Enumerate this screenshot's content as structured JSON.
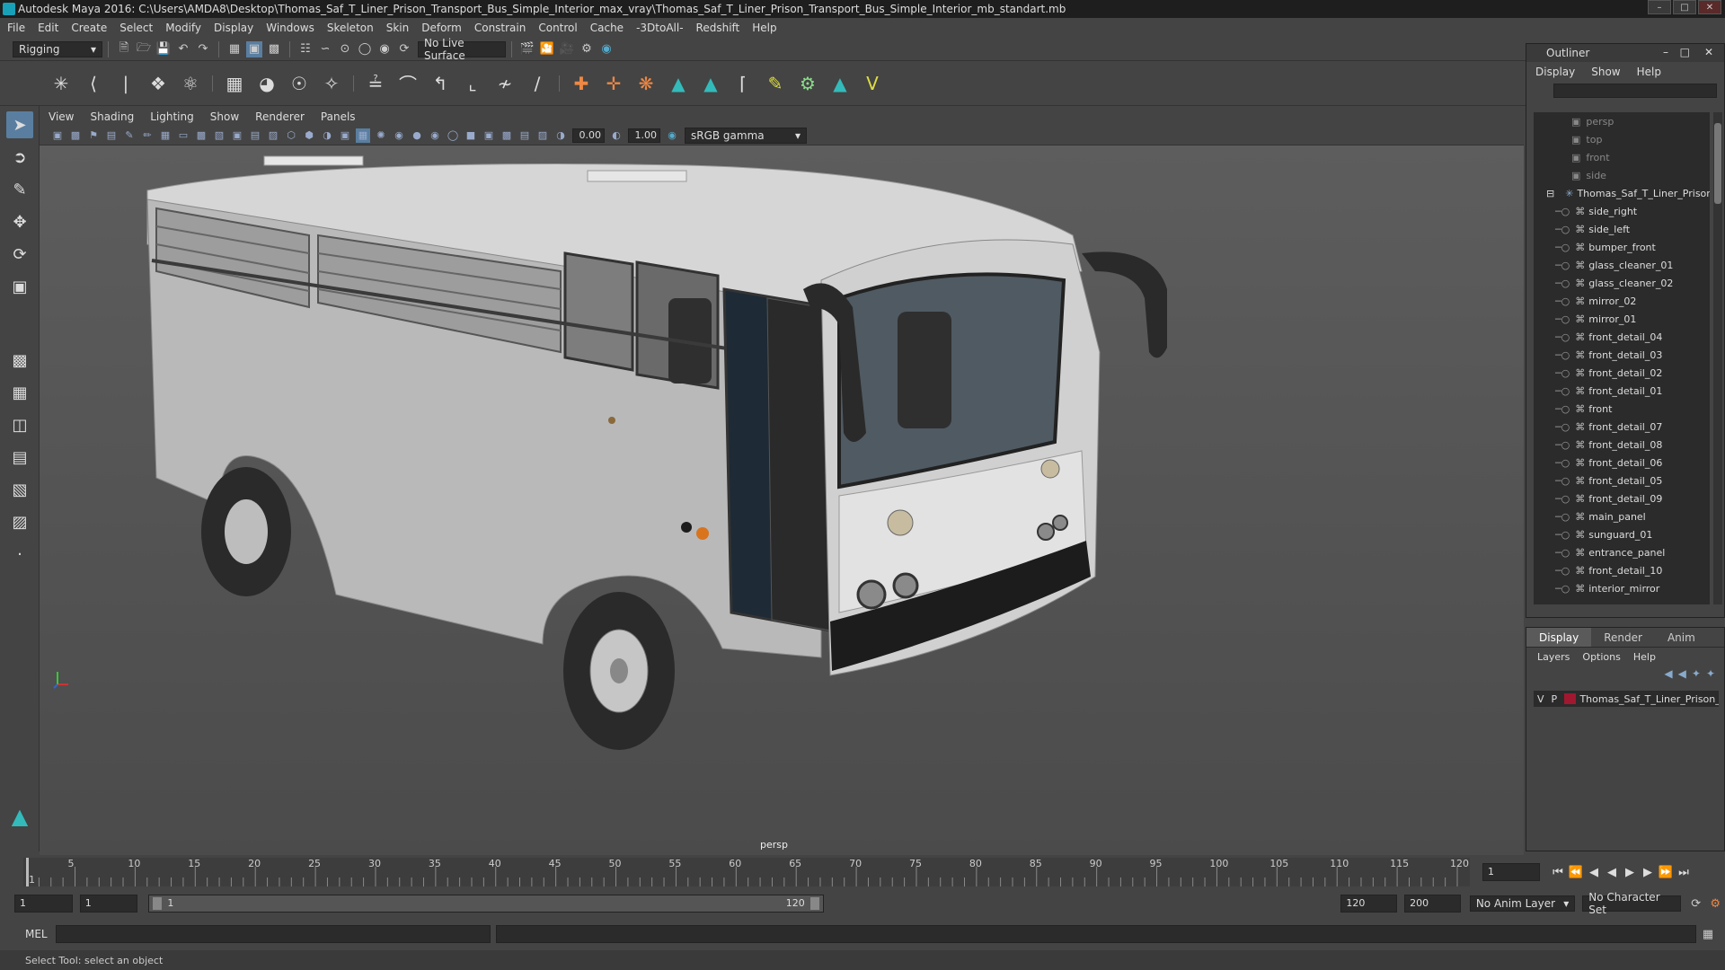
{
  "window": {
    "title": "Autodesk Maya 2016: C:\\Users\\AMDA8\\Desktop\\Thomas_Saf_T_Liner_Prison_Transport_Bus_Simple_Interior_max_vray\\Thomas_Saf_T_Liner_Prison_Transport_Bus_Simple_Interior_mb_standart.mb"
  },
  "menubar": [
    "File",
    "Edit",
    "Create",
    "Select",
    "Modify",
    "Display",
    "Windows",
    "Skeleton",
    "Skin",
    "Deform",
    "Constrain",
    "Control",
    "Cache",
    "-3DtoAll-",
    "Redshift",
    "Help"
  ],
  "statusline": {
    "menuset": "Rigging",
    "live_surface": "No Live Surface"
  },
  "panel": {
    "menus": [
      "View",
      "Shading",
      "Lighting",
      "Show",
      "Renderer",
      "Panels"
    ],
    "exposure": "0.00",
    "gamma": "1.00",
    "colorspace": "sRGB gamma",
    "camera": "persp"
  },
  "outliner": {
    "title": "Outliner",
    "menus": [
      "Display",
      "Show",
      "Help"
    ],
    "cameras": [
      "persp",
      "top",
      "front",
      "side"
    ],
    "root": "Thomas_Saf_T_Liner_Prison",
    "children": [
      "side_right",
      "side_left",
      "bumper_front",
      "glass_cleaner_01",
      "glass_cleaner_02",
      "mirror_02",
      "mirror_01",
      "front_detail_04",
      "front_detail_03",
      "front_detail_02",
      "front_detail_01",
      "front",
      "front_detail_07",
      "front_detail_08",
      "front_detail_06",
      "front_detail_05",
      "front_detail_09",
      "main_panel",
      "sunguard_01",
      "entrance_panel",
      "front_detail_10",
      "interior_mirror"
    ]
  },
  "layers": {
    "tabs": [
      "Display",
      "Render",
      "Anim"
    ],
    "menus": [
      "Layers",
      "Options",
      "Help"
    ],
    "row": {
      "v": "V",
      "p": "P",
      "name": "Thomas_Saf_T_Liner_Prison_T",
      "color": "#a01830"
    }
  },
  "timeline": {
    "ticks": [
      1,
      5,
      10,
      15,
      20,
      25,
      30,
      35,
      40,
      45,
      50,
      55,
      60,
      65,
      70,
      75,
      80,
      85,
      90,
      95,
      100,
      105,
      110,
      115,
      120
    ],
    "current_frame": "1"
  },
  "range": {
    "start": "1",
    "playback_start": "1",
    "slider_start": "1",
    "slider_end": "120",
    "playback_end": "120",
    "end": "200",
    "anim_layer": "No Anim Layer",
    "char_set": "No Character Set"
  },
  "cmdline": {
    "label": "MEL"
  },
  "helpline": {
    "text": "Select Tool: select an object"
  }
}
